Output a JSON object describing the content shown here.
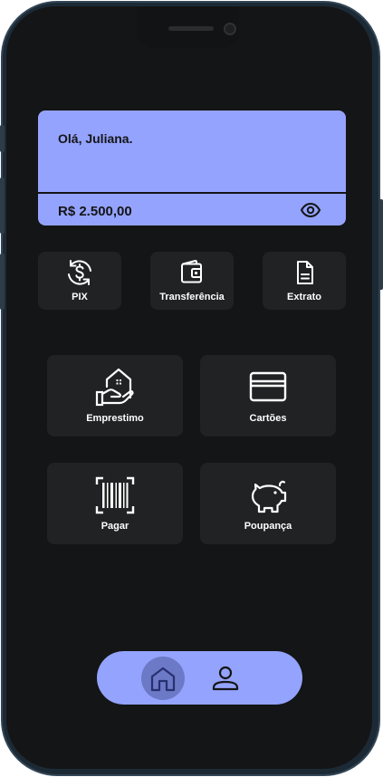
{
  "colors": {
    "accent": "#94a3fd",
    "background": "#141516",
    "tile": "#212223",
    "home_active": "#6c79c6"
  },
  "header": {
    "greeting": "Olá, Juliana."
  },
  "balance": {
    "amount": "R$ 2.500,00",
    "toggle_icon": "eye-icon"
  },
  "quick_actions": [
    {
      "label": "PIX",
      "icon": "pix-exchange-icon"
    },
    {
      "label": "Transferência",
      "icon": "wallet-icon"
    },
    {
      "label": "Extrato",
      "icon": "document-icon"
    }
  ],
  "services": [
    {
      "label": "Emprestimo",
      "icon": "house-hand-icon"
    },
    {
      "label": "Cartões",
      "icon": "credit-card-icon"
    },
    {
      "label": "Pagar",
      "icon": "barcode-icon"
    },
    {
      "label": "Poupança",
      "icon": "piggy-bank-icon"
    }
  ],
  "bottom_nav": {
    "items": [
      "home-icon",
      "profile-icon"
    ],
    "active": "home-icon"
  }
}
